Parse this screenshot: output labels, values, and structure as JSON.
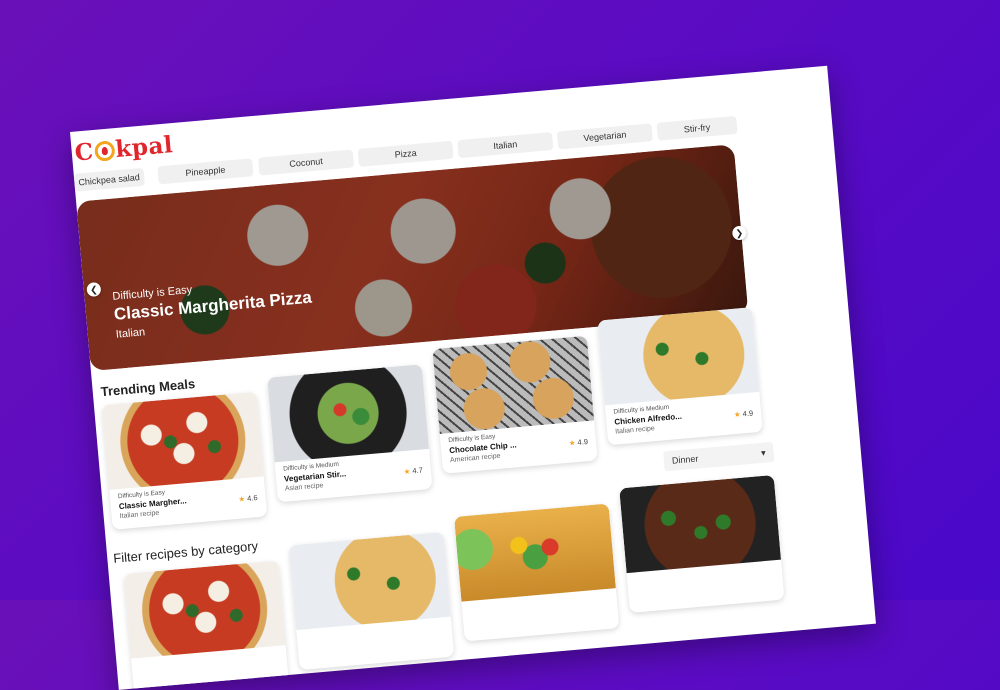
{
  "brand": {
    "pre": "C",
    "post": "kpal"
  },
  "categories": [
    "Chickpea salad",
    "Pineapple",
    "Coconut",
    "Pizza",
    "Italian",
    "Vegetarian",
    "Stir-fry"
  ],
  "hero": {
    "difficulty": "Difficulty is Easy",
    "title": "Classic Margherita Pizza",
    "cuisine": "Italian",
    "prev_icon": "chevron-left-icon",
    "next_icon": "chevron-right-icon"
  },
  "trending": {
    "title": "Trending Meals",
    "cards": [
      {
        "difficulty": "Difficulty is Easy",
        "name": "Classic Margher...",
        "cuisine": "Italian recipe",
        "rating": "4.6",
        "image": "pizza"
      },
      {
        "difficulty": "Difficulty is Medium",
        "name": "Vegetarian Stir...",
        "cuisine": "Asian recipe",
        "rating": "4.7",
        "image": "stir-fry"
      },
      {
        "difficulty": "Difficulty is Easy",
        "name": "Chocolate Chip ...",
        "cuisine": "American recipe",
        "rating": "4.9",
        "image": "cookies"
      },
      {
        "difficulty": "Difficulty is Medium",
        "name": "Chicken Alfredo...",
        "cuisine": "Italian recipe",
        "rating": "4.9",
        "image": "pasta"
      }
    ]
  },
  "filter": {
    "title": "Filter recipes by category",
    "selected": "Dinner",
    "dropdown_icon": "chevron-down-icon",
    "cards": [
      {
        "image": "pizza"
      },
      {
        "image": "pasta"
      },
      {
        "image": "salad"
      },
      {
        "image": "beef"
      }
    ]
  },
  "colors": {
    "brand": "#e0262c",
    "background": "#5d0cc2",
    "star": "#f4a623"
  }
}
